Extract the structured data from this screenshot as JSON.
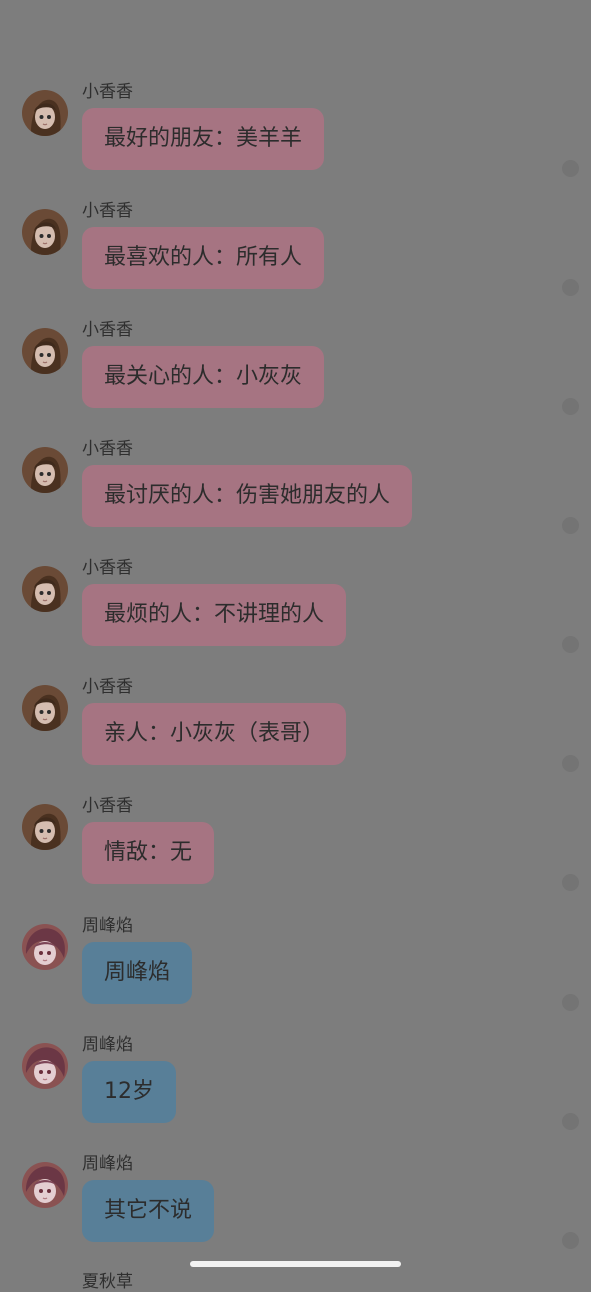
{
  "messages": [
    {
      "sender": "小香香",
      "text": "最好的朋友：美羊羊",
      "color": "#a67482"
    },
    {
      "sender": "小香香",
      "text": "最喜欢的人：所有人",
      "color": "#a67482"
    },
    {
      "sender": "小香香",
      "text": "最关心的人：小灰灰",
      "color": "#a67482"
    },
    {
      "sender": "小香香",
      "text": "最讨厌的人：伤害她朋友的人",
      "color": "#a67482"
    },
    {
      "sender": "小香香",
      "text": "最烦的人：不讲理的人",
      "color": "#a67482"
    },
    {
      "sender": "小香香",
      "text": "亲人：小灰灰（表哥）",
      "color": "#a67482"
    },
    {
      "sender": "小香香",
      "text": "情敌：无",
      "color": "#a67482"
    },
    {
      "sender": "周峰焰",
      "text": "周峰焰",
      "color": "#587f98"
    },
    {
      "sender": "周峰焰",
      "text": "12岁",
      "color": "#587f98"
    },
    {
      "sender": "周峰焰",
      "text": "其它不说",
      "color": "#587f98"
    }
  ],
  "next_sender_partial": "夏秋草"
}
